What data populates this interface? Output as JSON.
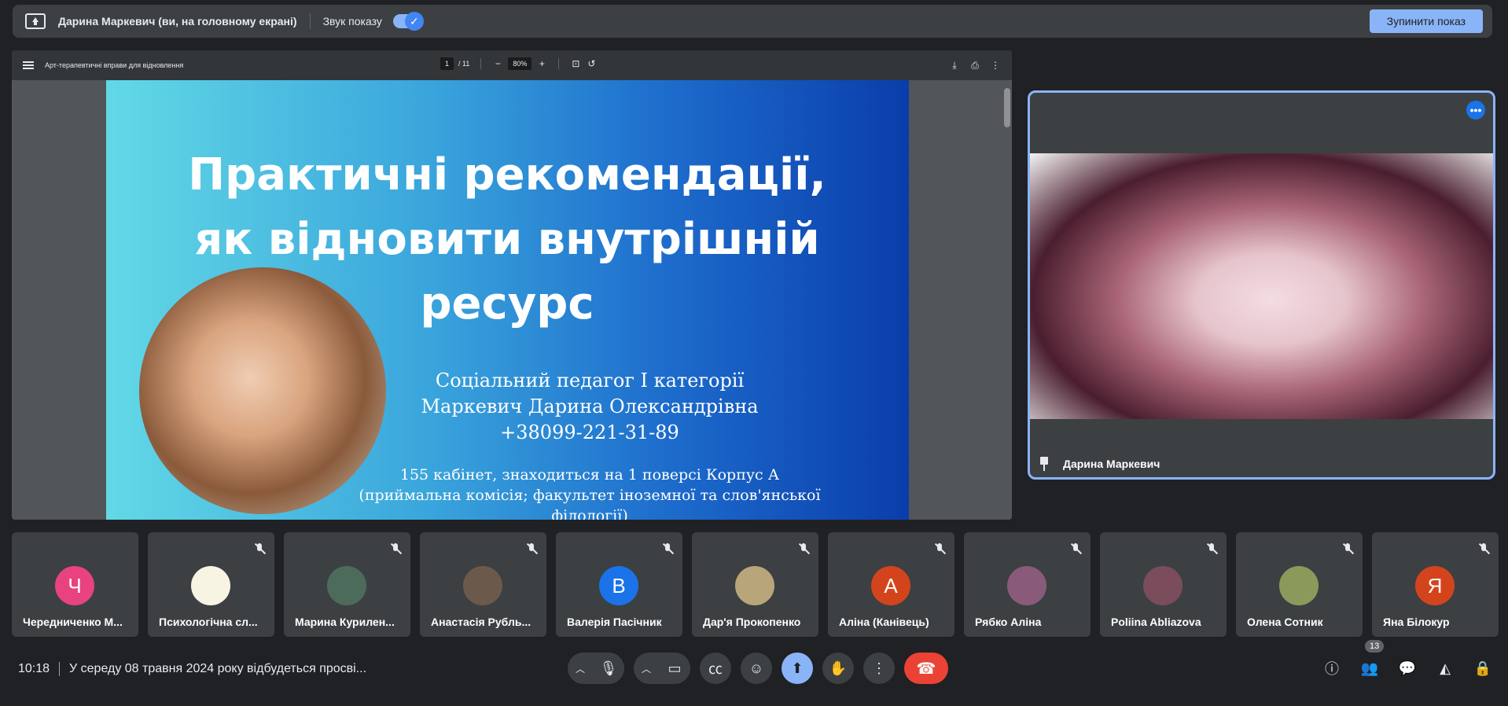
{
  "present_bar": {
    "title": "Дарина Маркевич (ви, на головному екрані)",
    "sound_label": "Звук показу",
    "stop_button": "Зупинити показ"
  },
  "pdf": {
    "title": "Арт-терапевтичні вправи для відновлення",
    "page_current": "1",
    "page_total": "/ 11",
    "zoom": "80%",
    "zoom_out": "−",
    "zoom_in": "+",
    "slide": {
      "title_lines": [
        "Практичні рекомендації,",
        "як відновити внутрішній",
        "ресурс"
      ],
      "line1": "Соціальний педагог I категорії",
      "line2": "Маркевич Дарина Олександрівна",
      "line3": "+38099-221-31-89",
      "line4": "155 кабінет, знаходиться на 1 поверсі Корпус А",
      "line5": "(приймальна комісія; факультет іноземної та слов'янської філології)"
    }
  },
  "speaker": {
    "name": "Дарина Маркевич",
    "more": "•••"
  },
  "participants": [
    {
      "name": "Чередниченко М...",
      "initial": "Ч",
      "color": "#e8437f",
      "muted": false
    },
    {
      "name": "Психологічна сл...",
      "initial": "",
      "color": "#f8f4e4",
      "muted": true
    },
    {
      "name": "Марина Курилен...",
      "initial": "",
      "color": "#4d6b5b",
      "muted": true
    },
    {
      "name": "Анастасія Рубль...",
      "initial": "",
      "color": "#6b5a4c",
      "muted": true
    },
    {
      "name": "Валерія Пасічник",
      "initial": "В",
      "color": "#1a73e8",
      "muted": true
    },
    {
      "name": "Дар'я Прокопенко",
      "initial": "",
      "color": "#b8a67a",
      "muted": true
    },
    {
      "name": "Аліна (Канівець)",
      "initial": "А",
      "color": "#d4441c",
      "muted": true
    },
    {
      "name": "Рябко Аліна",
      "initial": "",
      "color": "#8a5a7a",
      "muted": true
    },
    {
      "name": "Poliina Abliazova",
      "initial": "",
      "color": "#7a4c5c",
      "muted": true
    },
    {
      "name": "Олена Сотник",
      "initial": "",
      "color": "#8a9a5a",
      "muted": true
    },
    {
      "name": "Яна Білокур",
      "initial": "Я",
      "color": "#d4441c",
      "muted": true
    }
  ],
  "bottom": {
    "time": "10:18",
    "meeting_title": "У середу 08 травня 2024 року відбудеться просві...",
    "people_count": "13"
  }
}
